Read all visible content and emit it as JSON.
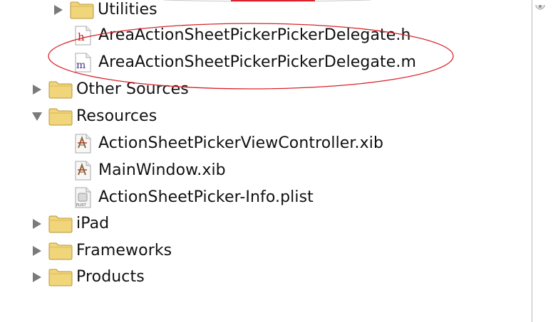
{
  "navigator": {
    "items": [
      {
        "label": "Utilities",
        "kind": "folder",
        "disclosure": "collapsed"
      },
      {
        "label": "AreaActionSheetPickerPickerDelegate.h",
        "kind": "header-file",
        "badge": "h"
      },
      {
        "label": "AreaActionSheetPickerPickerDelegate.m",
        "kind": "implementation-file",
        "badge": "m"
      },
      {
        "label": "Other Sources",
        "kind": "folder",
        "disclosure": "collapsed"
      },
      {
        "label": "Resources",
        "kind": "folder",
        "disclosure": "expanded"
      },
      {
        "label": "ActionSheetPickerViewController.xib",
        "kind": "xib-file"
      },
      {
        "label": "MainWindow.xib",
        "kind": "xib-file"
      },
      {
        "label": "ActionSheetPicker-Info.plist",
        "kind": "plist-file",
        "badge": "PLIST"
      },
      {
        "label": "iPad",
        "kind": "folder",
        "disclosure": "collapsed"
      },
      {
        "label": "Frameworks",
        "kind": "folder",
        "disclosure": "collapsed"
      },
      {
        "label": "Products",
        "kind": "folder",
        "disclosure": "collapsed"
      }
    ]
  },
  "colors": {
    "annotation_ellipse": "#d8232a",
    "folder_fill": "#f1d57a",
    "disclosure": "#7a7a7a",
    "m_badge": "#4b2c8a",
    "h_badge": "#b3261e"
  }
}
